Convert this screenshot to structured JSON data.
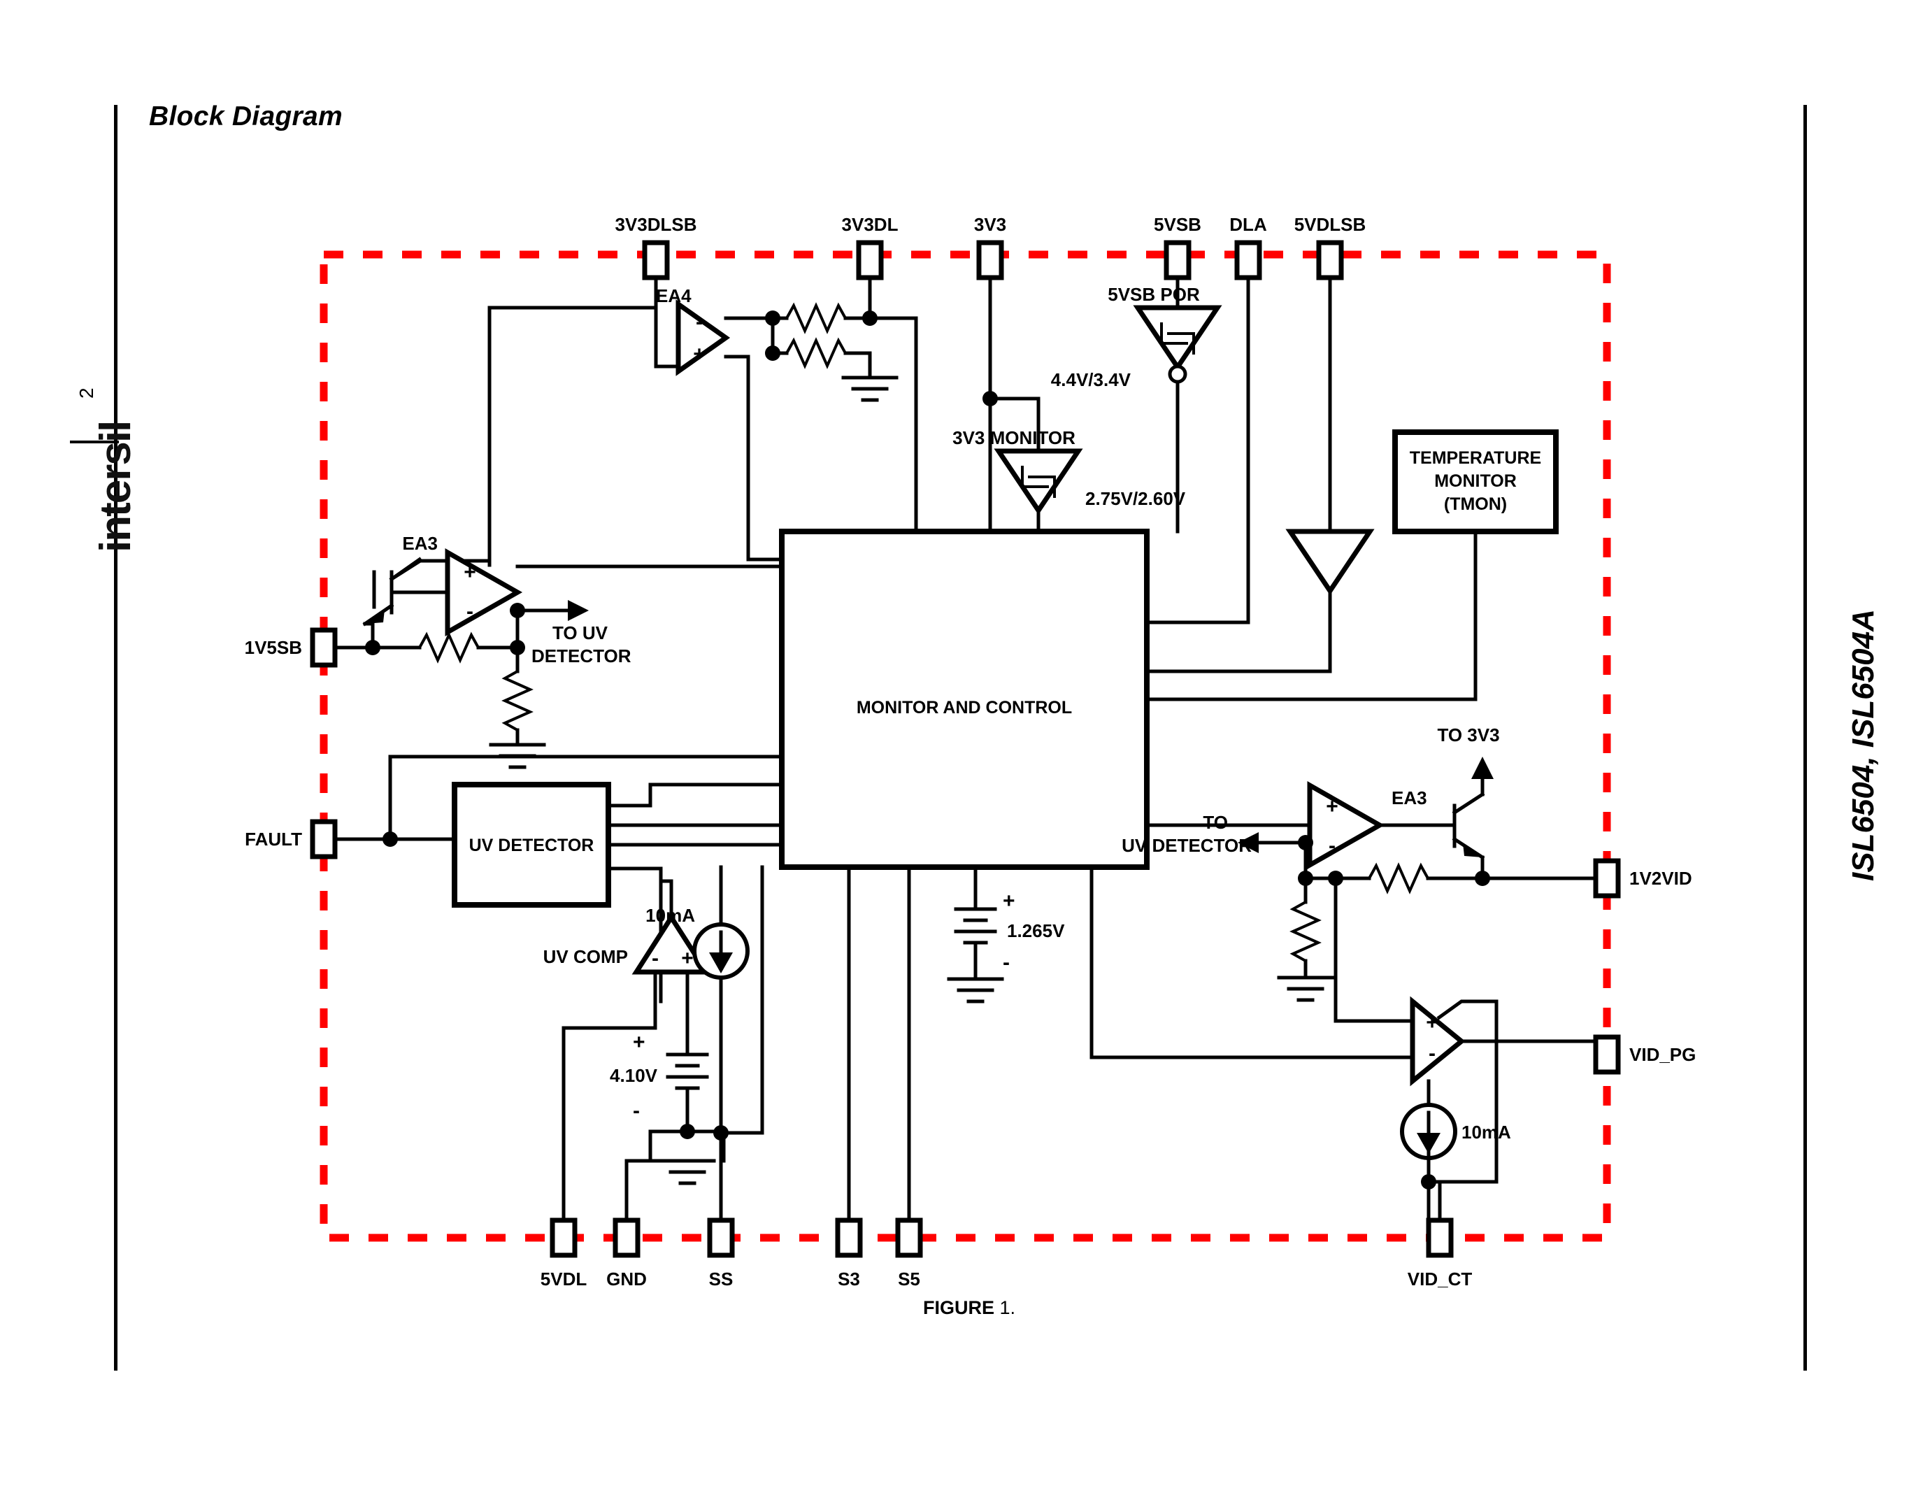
{
  "document": {
    "title": "Block Diagram",
    "page_number": "2",
    "brand": "intersil",
    "part_number": "ISL6504, ISL6504A",
    "figure_caption_text": "FIGURE",
    "figure_caption_number": "1."
  },
  "diagram": {
    "boundary_color": "#FF0000",
    "pins_top": [
      {
        "name": "3V3DLSB"
      },
      {
        "name": "3V3DL"
      },
      {
        "name": "3V3"
      },
      {
        "name": "5VSB"
      },
      {
        "name": "DLA"
      },
      {
        "name": "5VDLSB"
      }
    ],
    "pins_left": [
      {
        "name": "1V5SB"
      },
      {
        "name": "FAULT"
      }
    ],
    "pins_right": [
      {
        "name": "1V2VID"
      },
      {
        "name": "VID_PG"
      }
    ],
    "pins_bottom": [
      {
        "name": "5VDL"
      },
      {
        "name": "GND"
      },
      {
        "name": "SS"
      },
      {
        "name": "S3"
      },
      {
        "name": "S5"
      },
      {
        "name": "VID_CT"
      }
    ],
    "blocks": [
      {
        "id": "monitor_control",
        "label": "MONITOR AND CONTROL"
      },
      {
        "id": "uv_detector",
        "label": "UV DETECTOR"
      },
      {
        "id": "temperature_monitor",
        "line1": "TEMPERATURE",
        "line2": "MONITOR",
        "line3": "(TMON)"
      }
    ],
    "amplifiers": [
      {
        "id": "ea4",
        "label": "EA4",
        "in_top": "-",
        "in_bottom": "+"
      },
      {
        "id": "ea3_left",
        "label": "EA3",
        "in_top": "+",
        "in_bottom": "-"
      },
      {
        "id": "ea3_right",
        "label": "EA3",
        "in_top": "+",
        "in_bottom": "-"
      },
      {
        "id": "uv_comp",
        "label": "UV COMP",
        "in_left": "-",
        "in_right": "+"
      },
      {
        "id": "vid_pg_comp",
        "label": "",
        "in_top": "+",
        "in_bottom": "-"
      }
    ],
    "comparators": [
      {
        "id": "por_5vsb",
        "label": "5VSB POR",
        "threshold": "4.4V/3.4V"
      },
      {
        "id": "monitor_3v3",
        "label": "3V3 MONITOR",
        "threshold": "2.75V/2.60V"
      }
    ],
    "references": [
      {
        "id": "ref_410",
        "value": "4.10V",
        "plus": "+",
        "minus": "-"
      },
      {
        "id": "ref_1265",
        "value": "1.265V",
        "plus": "+",
        "minus": "-"
      }
    ],
    "current_sources": [
      {
        "id": "isrc_ss",
        "value": "10mA"
      },
      {
        "id": "isrc_vidct",
        "value": "10mA"
      }
    ],
    "annotations": [
      {
        "id": "to_uv_detector_left",
        "line1": "TO UV",
        "line2": "DETECTOR"
      },
      {
        "id": "to_uv_detector_right",
        "line1": "TO",
        "line2": "UV DETECTOR"
      },
      {
        "id": "to_3v3",
        "line1": "TO 3V3"
      }
    ]
  }
}
